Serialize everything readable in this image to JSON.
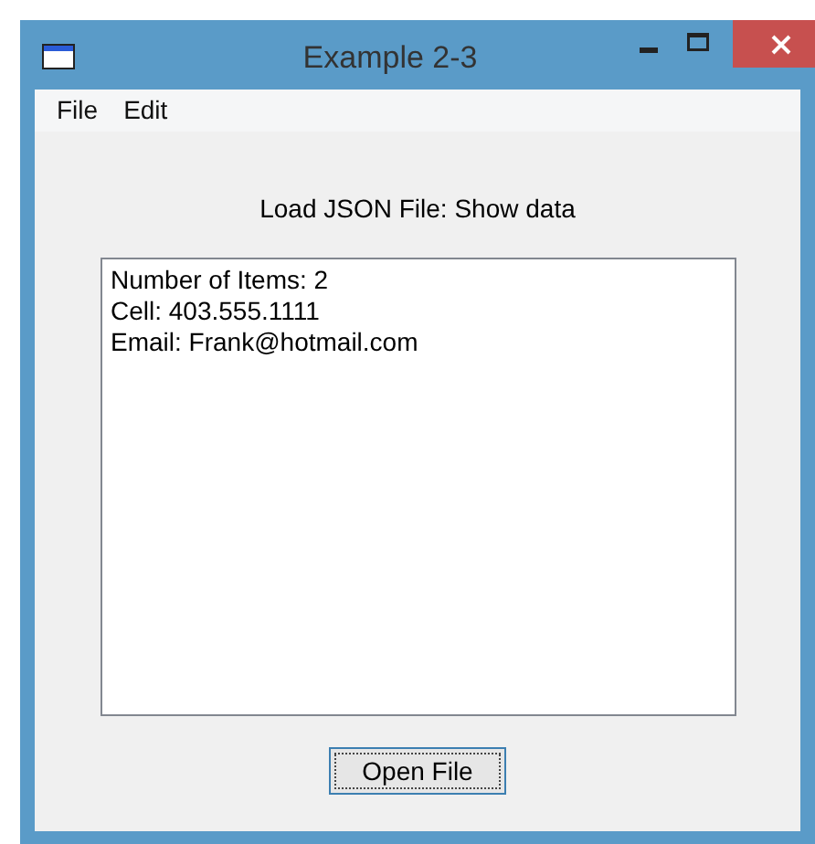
{
  "window": {
    "title": "Example 2-3"
  },
  "menu": [
    "File",
    "Edit"
  ],
  "heading": "Load JSON File: Show data",
  "text_area": {
    "lines": [
      "Number of Items: 2",
      "Cell: 403.555.1111",
      "Email: Frank@hotmail.com"
    ]
  },
  "button": {
    "label": "Open File",
    "focused": true
  }
}
